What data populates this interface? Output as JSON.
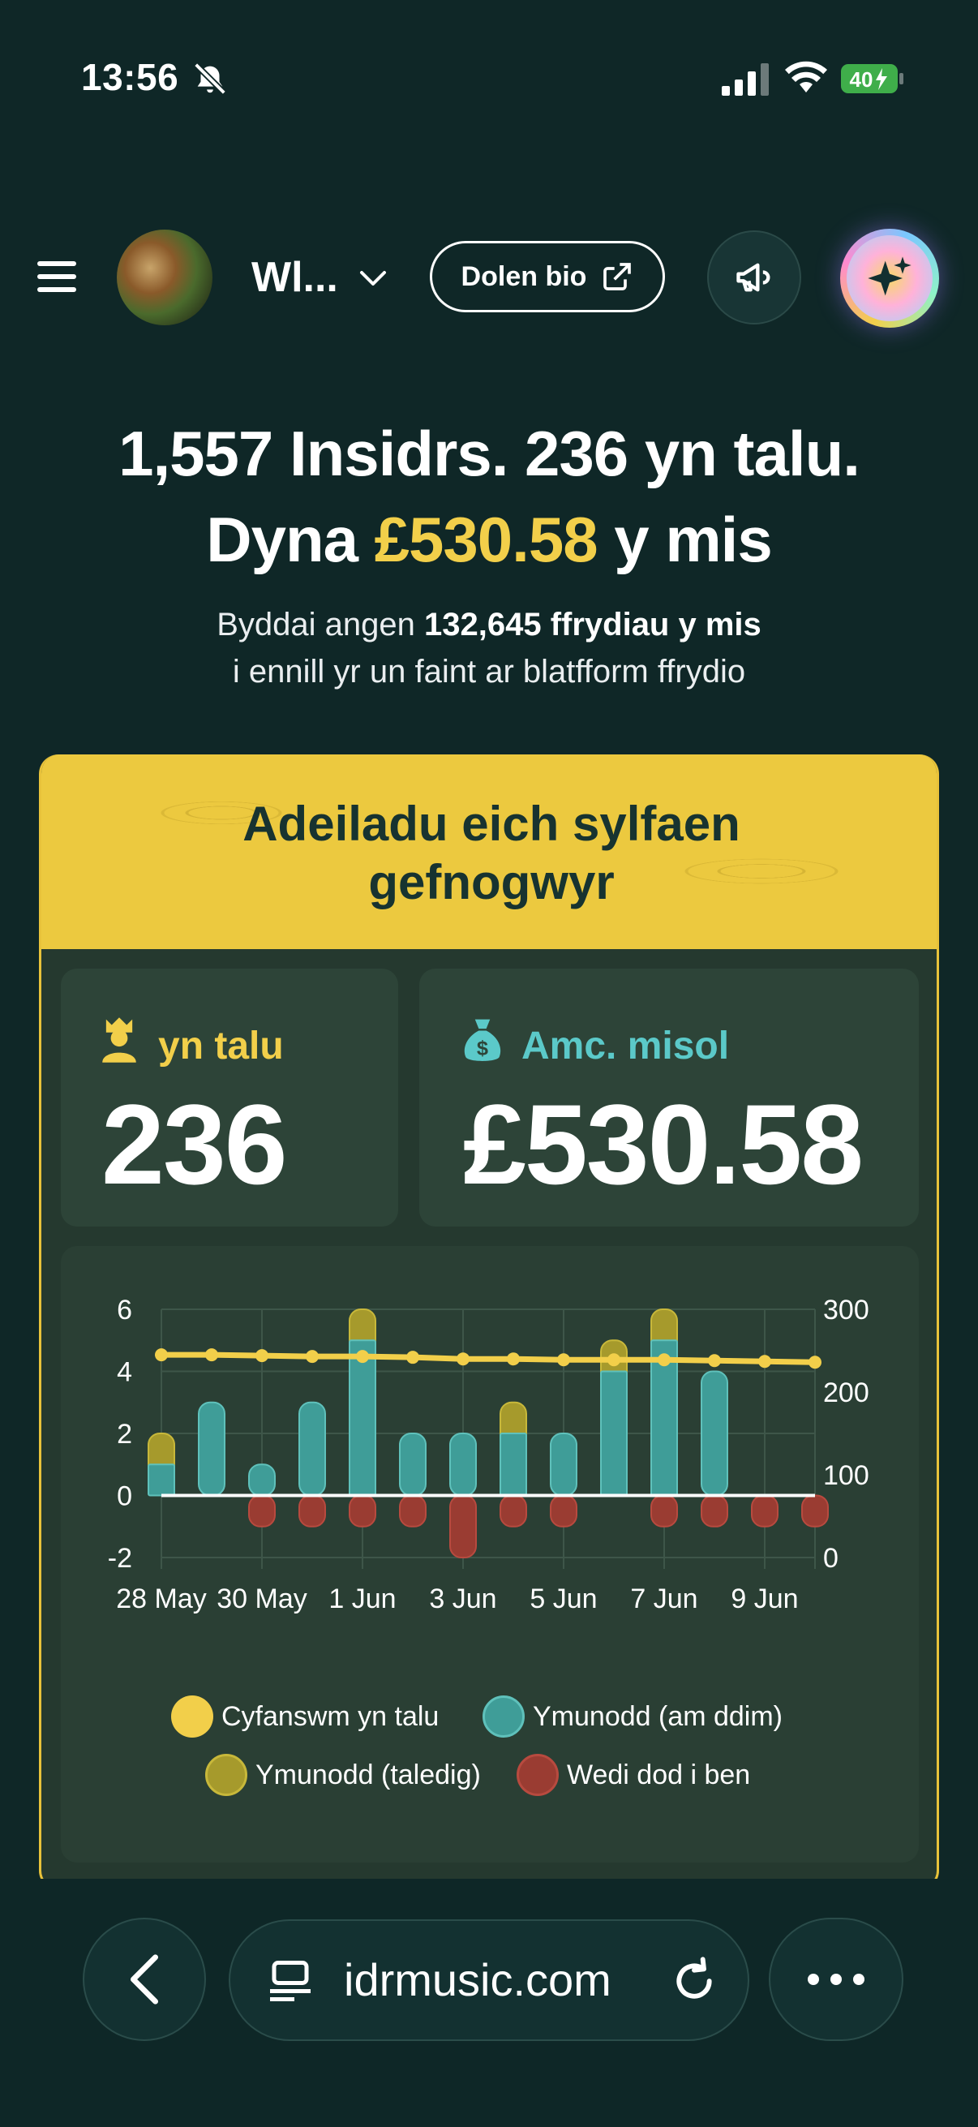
{
  "status_bar": {
    "time": "13:56",
    "battery": "40"
  },
  "header": {
    "account_name": "Wl...",
    "bio_link_label": "Dolen bio"
  },
  "headline": {
    "line1": "1,557 Insidrs. 236 yn talu.",
    "line2_prefix": "Dyna ",
    "line2_amount": "£530.58",
    "line2_suffix": " y mis",
    "sub1_prefix": "Byddai angen ",
    "sub1_bold": "132,645 ffrydiau y mis",
    "sub2": "i ennill yr un faint ar blatfform ffrydio"
  },
  "card": {
    "title_line1": "Adeiladu eich sylfaen",
    "title_line2": "gefnogwyr",
    "paying_label": "yn talu",
    "paying_value": "236",
    "income_label": "Amc. misol",
    "income_value": "£530.58"
  },
  "chart_data": {
    "type": "bar",
    "categories": [
      "28 May",
      "29 May",
      "30 May",
      "31 May",
      "1 Jun",
      "2 Jun",
      "3 Jun",
      "4 Jun",
      "5 Jun",
      "6 Jun",
      "7 Jun",
      "8 Jun",
      "9 Jun",
      "10 Jun"
    ],
    "x_tick_labels": [
      "28 May",
      "30 May",
      "1 Jun",
      "3 Jun",
      "5 Jun",
      "7 Jun",
      "9 Jun"
    ],
    "left_axis": {
      "ticks": [
        "6",
        "4",
        "2",
        "0",
        "-2"
      ],
      "ylim": [
        -2,
        6
      ]
    },
    "right_axis": {
      "ticks": [
        "300",
        "200",
        "100",
        "0"
      ],
      "ylim": [
        0,
        300
      ]
    },
    "series": [
      {
        "name": "Ymunodd (am ddim)",
        "color": "#3f9d98",
        "values": [
          1,
          3,
          1,
          3,
          5,
          2,
          2,
          2,
          2,
          4,
          5,
          4,
          0,
          0
        ]
      },
      {
        "name": "Ymunodd (taledig)",
        "color": "#a69a2c",
        "values": [
          1,
          0,
          0,
          0,
          1,
          0,
          0,
          1,
          0,
          1,
          1,
          0,
          0,
          0
        ]
      },
      {
        "name": "Wedi dod i ben",
        "color": "#9a3c32",
        "values": [
          0,
          0,
          -1,
          -1,
          -1,
          -1,
          -2,
          -1,
          -1,
          0,
          -1,
          -1,
          -1,
          -1
        ]
      },
      {
        "name": "Cyfanswm yn talu",
        "color": "#f2cf4a",
        "axis": "right",
        "values": [
          245,
          245,
          244,
          243,
          243,
          242,
          240,
          240,
          239,
          239,
          239,
          238,
          237,
          236
        ]
      }
    ],
    "grid": true
  },
  "legend": {
    "total": "Cyfanswm yn talu",
    "free": "Ymunodd (am ddim)",
    "paid": "Ymunodd (taledig)",
    "ended": "Wedi dod i ben"
  },
  "browser": {
    "url": "idrmusic.com"
  },
  "colors": {
    "accent": "#f2cf4a",
    "teal": "#5bc9c9",
    "background": "#0f2727"
  }
}
